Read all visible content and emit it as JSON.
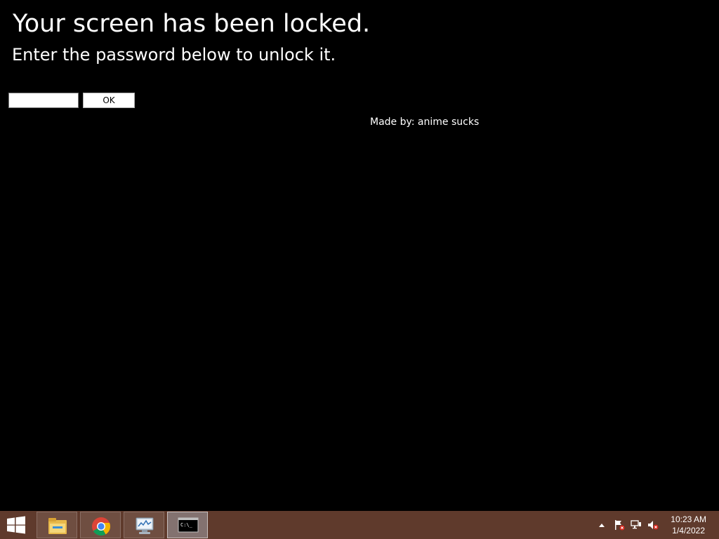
{
  "lock": {
    "title": "Your screen has been locked.",
    "subtitle": "Enter the password below to unlock it.",
    "password_value": "",
    "ok_label": "OK",
    "credit": "Made by: anime sucks"
  },
  "taskbar": {
    "pinned": [
      {
        "icon": "file-explorer-icon",
        "active": false
      },
      {
        "icon": "chrome-icon",
        "active": false
      },
      {
        "icon": "performance-monitor-icon",
        "active": false
      },
      {
        "icon": "command-prompt-icon",
        "active": true
      }
    ],
    "cmd_glyph": "C:\\_",
    "clock": {
      "time": "10:23 AM",
      "date": "1/4/2022"
    }
  },
  "colors": {
    "background": "#000000",
    "taskbar": "#5f3a2c"
  }
}
